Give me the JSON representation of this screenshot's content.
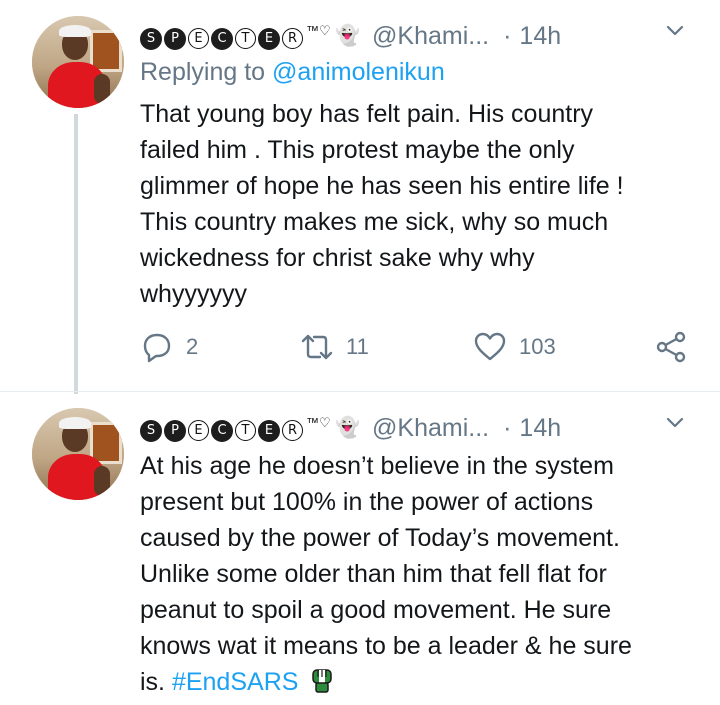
{
  "tweets": [
    {
      "display_name_letters": [
        "S",
        "P",
        "E",
        "C",
        "T",
        "E",
        "R"
      ],
      "display_name_suffix": "™♡",
      "ghost_icon": "👻",
      "handle": "@Khami...",
      "separator": "·",
      "time": "14h",
      "replying_prefix": "Replying to",
      "replying_to": "@animolenikun",
      "text_lines": [
        "That young boy has felt pain. His country",
        "failed him . This protest maybe the only",
        "glimmer of hope he has seen his entire life !",
        "This country makes me sick, why so much",
        "wickedness for christ sake why why",
        "whyyyyyy"
      ],
      "replies": "2",
      "retweets": "11",
      "likes": "103"
    },
    {
      "display_name_letters": [
        "S",
        "P",
        "E",
        "C",
        "T",
        "E",
        "R"
      ],
      "display_name_suffix": "™♡",
      "ghost_icon": "👻",
      "handle": "@Khami...",
      "separator": "·",
      "time": "14h",
      "text_lines": [
        "At his age he doesn’t believe in the system",
        "present but 100% in the power of actions",
        "caused by the power of Today’s movement.",
        "Unlike some older than him that fell flat for",
        "peanut to spoil a good movement. He sure",
        "knows wat it means to be a leader & he sure"
      ],
      "last_line_text": "is.",
      "hashtag": "#EndSARS"
    }
  ],
  "colors": {
    "link": "#1da1f2",
    "secondary": "#657786",
    "text": "#14171a",
    "divider": "#e6ecf0"
  },
  "icons": [
    "avatar",
    "ghost-icon",
    "chevron-down-icon",
    "reply-icon",
    "retweet-icon",
    "like-icon",
    "share-icon",
    "raised-fist-icon"
  ]
}
